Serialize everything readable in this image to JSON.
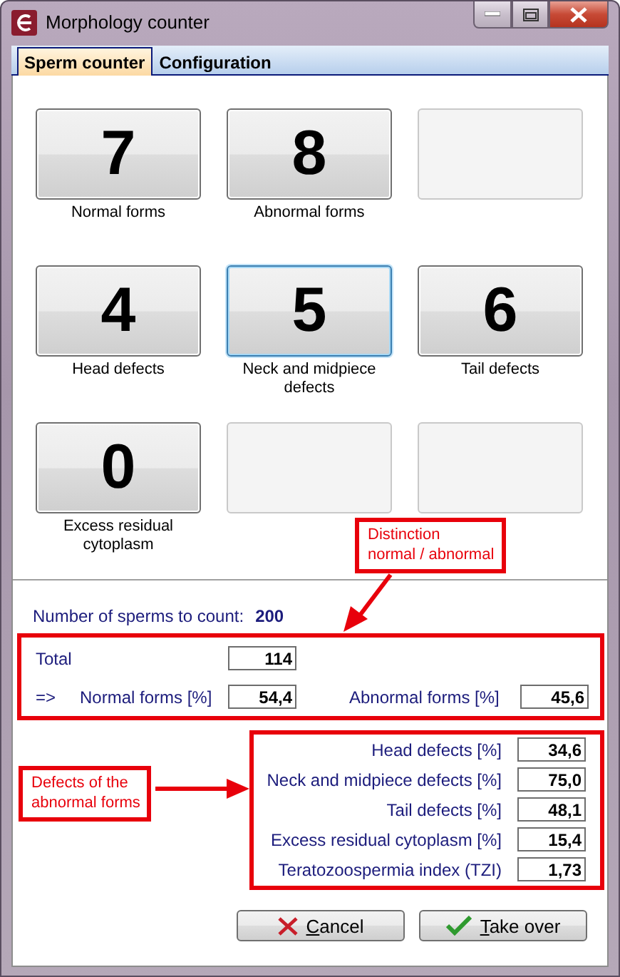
{
  "window": {
    "title": "Morphology counter"
  },
  "tabs": [
    {
      "label": "Sperm counter",
      "selected": true
    },
    {
      "label": "Configuration",
      "selected": false
    }
  ],
  "counters": [
    {
      "kind": "counter",
      "count": "7",
      "label": "Normal forms",
      "focused": false
    },
    {
      "kind": "counter",
      "count": "8",
      "label": "Abnormal forms",
      "focused": false
    },
    {
      "kind": "empty"
    },
    {
      "kind": "counter",
      "count": "4",
      "label": "Head defects",
      "focused": false
    },
    {
      "kind": "counter",
      "count": "5",
      "label": "Neck and midpiece defects",
      "focused": true
    },
    {
      "kind": "counter",
      "count": "6",
      "label": "Tail defects",
      "focused": false
    },
    {
      "kind": "counter",
      "count": "0",
      "label": "Excess residual cytoplasm",
      "focused": false
    },
    {
      "kind": "empty"
    },
    {
      "kind": "empty"
    }
  ],
  "sperms_to_count": {
    "label": "Number of sperms to count:",
    "value": "200"
  },
  "summary": {
    "total_label": "Total",
    "total": "114",
    "arrow": "=>",
    "normal_label": "Normal forms [%]",
    "normal": "54,4",
    "abnormal_label": "Abnormal forms [%]",
    "abnormal": "45,6"
  },
  "defects": [
    {
      "label": "Head defects [%]",
      "value": "34,6"
    },
    {
      "label": "Neck and midpiece defects [%]",
      "value": "75,0"
    },
    {
      "label": "Tail defects [%]",
      "value": "48,1"
    },
    {
      "label": "Excess residual cytoplasm [%]",
      "value": "15,4"
    },
    {
      "label": "Teratozoospermia index (TZI)",
      "value": "1,73"
    }
  ],
  "annotations": [
    {
      "kind": "summary",
      "lines": [
        "Distinction",
        "normal / abnormal"
      ]
    },
    {
      "kind": "defects",
      "lines": [
        "Defects of the",
        "abnormal forms"
      ]
    }
  ],
  "buttons": [
    {
      "kind": "cancel",
      "label": "Cancel"
    },
    {
      "kind": "ok",
      "label": "Take over"
    }
  ]
}
